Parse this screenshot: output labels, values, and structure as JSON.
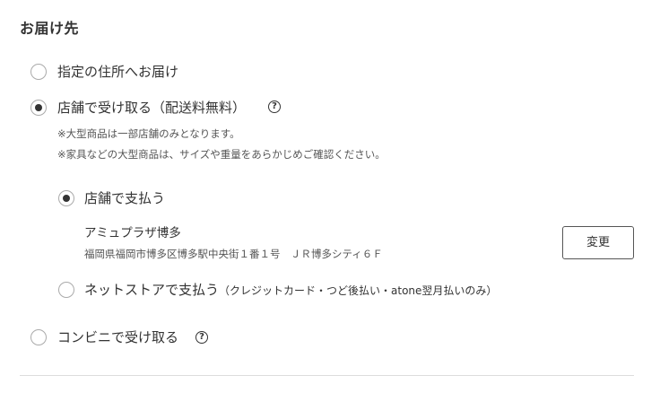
{
  "section": {
    "title": "お届け先"
  },
  "options": {
    "home": {
      "label": "指定の住所へお届け",
      "selected": false
    },
    "store": {
      "label": "店舗で受け取る（配送料無料）",
      "selected": true,
      "help": "?",
      "notes": [
        "※大型商品は一部店舗のみとなります。",
        "※家具などの大型商品は、サイズや重量をあらかじめご確認ください。"
      ],
      "payment": {
        "store_pay": {
          "label": "店舗で支払う",
          "selected": true
        },
        "store_info": {
          "name": "アミュプラザ博多",
          "address": "福岡県福岡市博多区博多駅中央街１番１号　ＪＲ博多シティ６Ｆ",
          "change_button": "変更"
        },
        "online_pay": {
          "label": "ネットストアで支払う",
          "sub": "（クレジットカード・つど後払い・atone翌月払いのみ）",
          "selected": false
        }
      }
    },
    "convenience": {
      "label": "コンビニで受け取る",
      "selected": false,
      "help": "?"
    }
  }
}
